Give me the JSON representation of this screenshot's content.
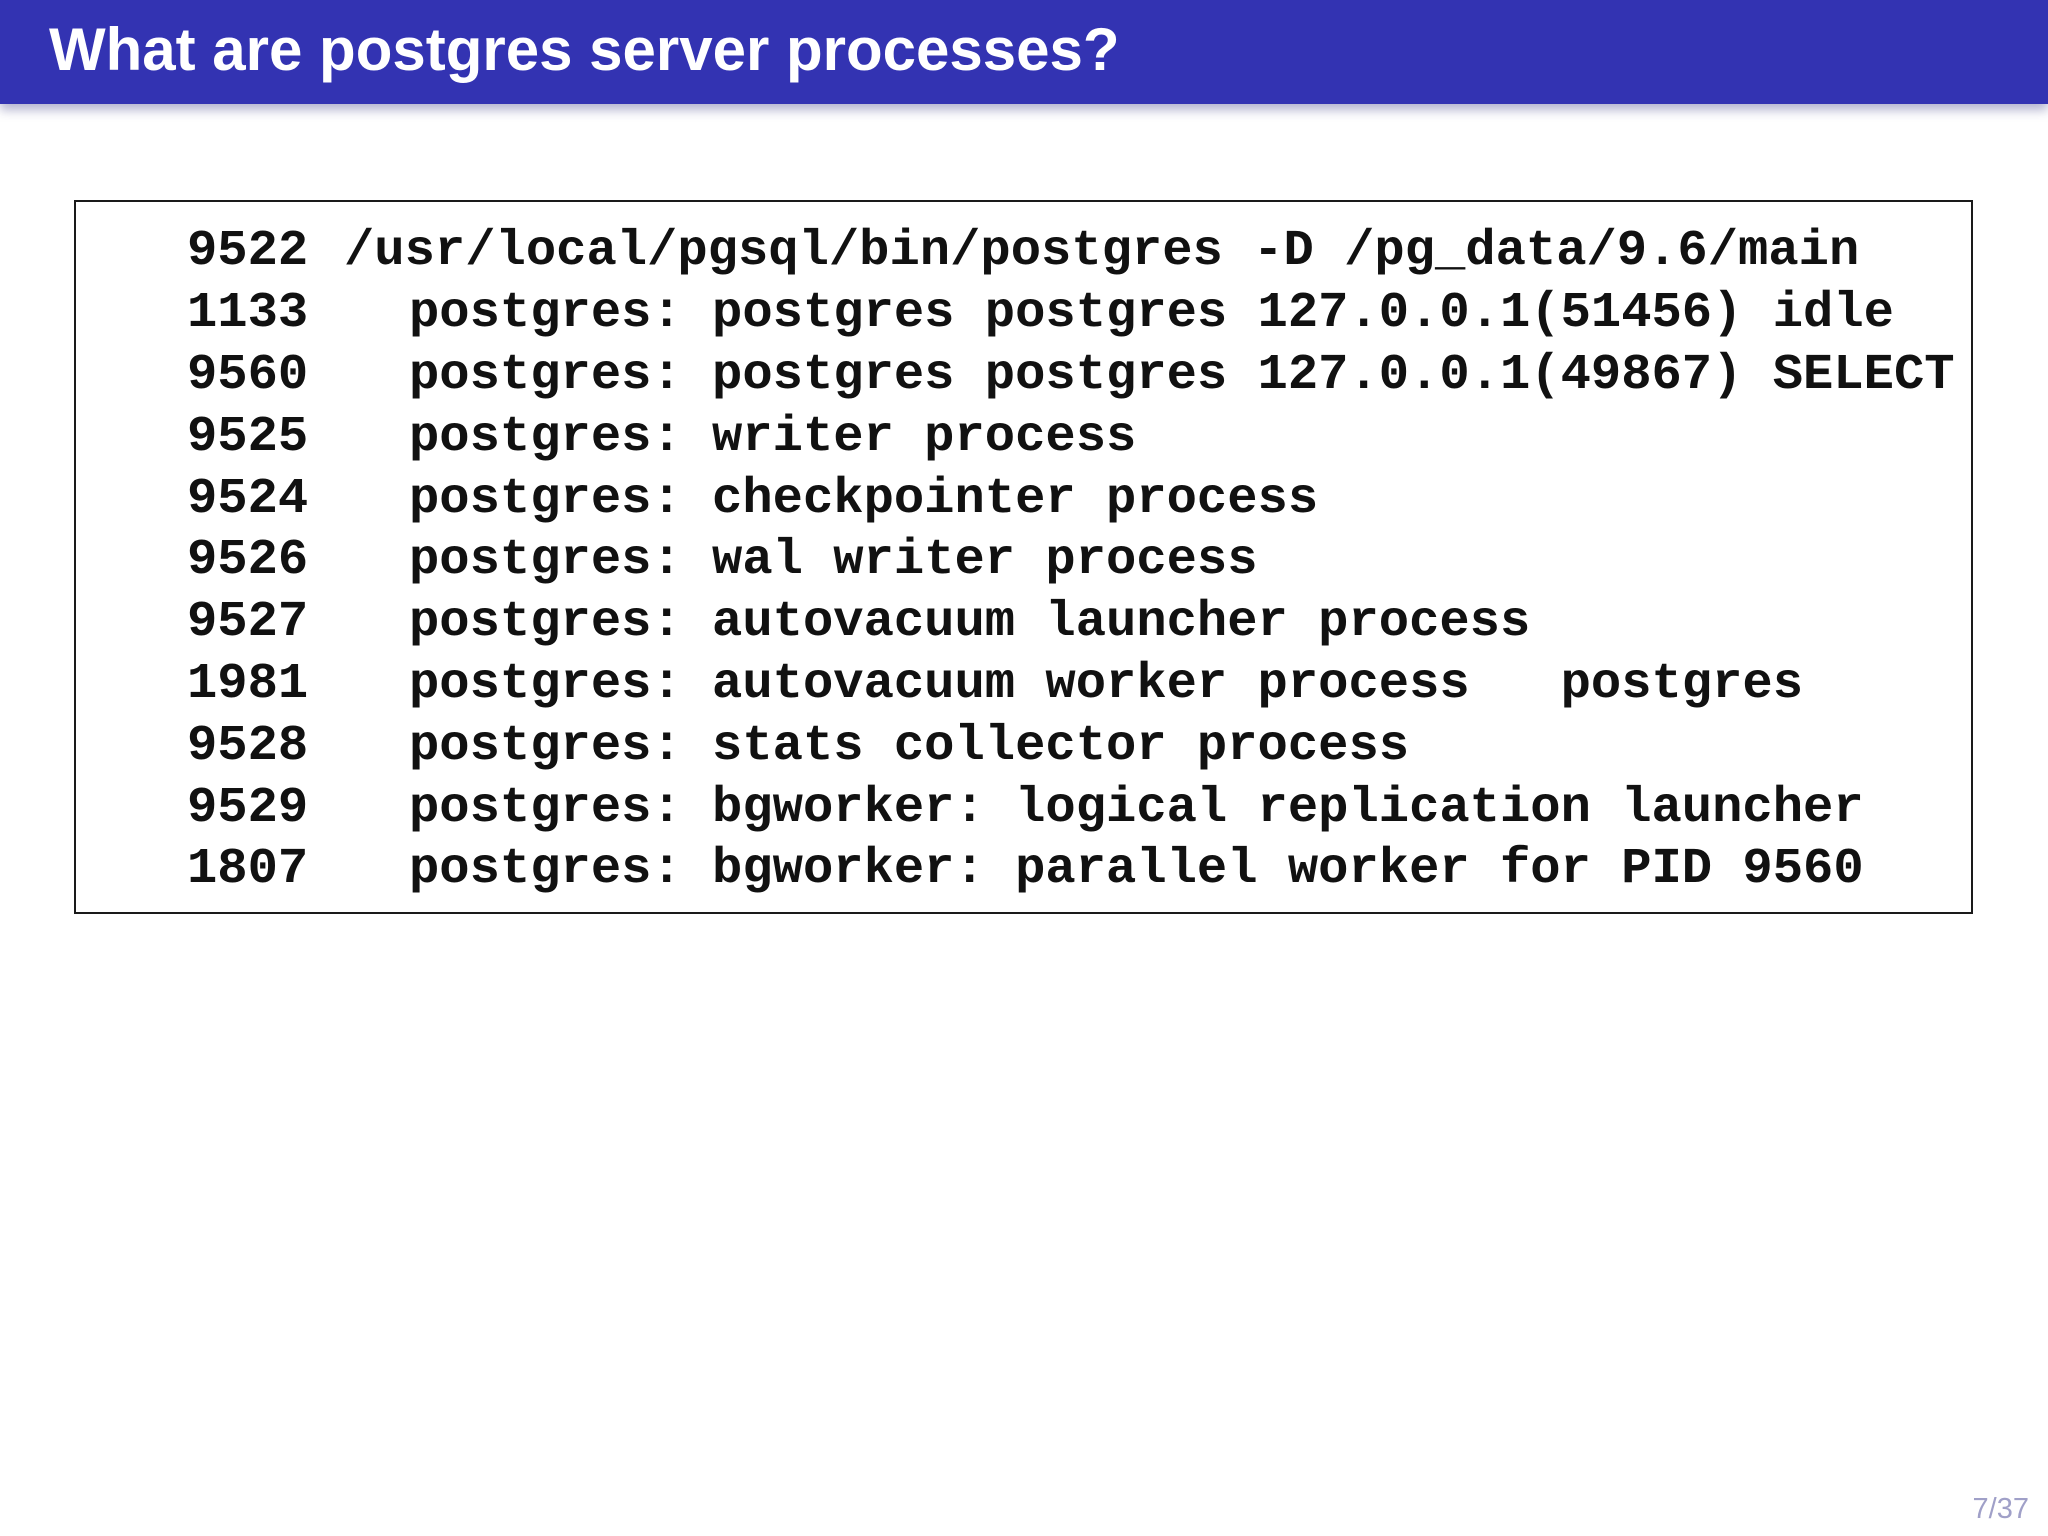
{
  "title": "What are postgres server processes?",
  "processes": [
    {
      "pid": "9522",
      "command": "/usr/local/pgsql/bin/postgres -D /pg_data/9.6/main"
    },
    {
      "pid": "1133",
      "command": "postgres: postgres postgres 127.0.0.1(51456) idle"
    },
    {
      "pid": "9560",
      "command": "postgres: postgres postgres 127.0.0.1(49867) SELECT"
    },
    {
      "pid": "9525",
      "command": "postgres: writer process"
    },
    {
      "pid": "9524",
      "command": "postgres: checkpointer process"
    },
    {
      "pid": "9526",
      "command": "postgres: wal writer process"
    },
    {
      "pid": "9527",
      "command": "postgres: autovacuum launcher process"
    },
    {
      "pid": "1981",
      "command": "postgres: autovacuum worker process   postgres"
    },
    {
      "pid": "9528",
      "command": "postgres: stats collector process"
    },
    {
      "pid": "9529",
      "command": "postgres: bgworker: logical replication launcher"
    },
    {
      "pid": "1807",
      "command": "postgres: bgworker: parallel worker for PID 9560"
    }
  ],
  "page_number": "7/37",
  "colors": {
    "title_bar": "#3333b2",
    "title_text": "#ffffff",
    "code_text": "#111111",
    "page_number": "#a0a0c8"
  }
}
